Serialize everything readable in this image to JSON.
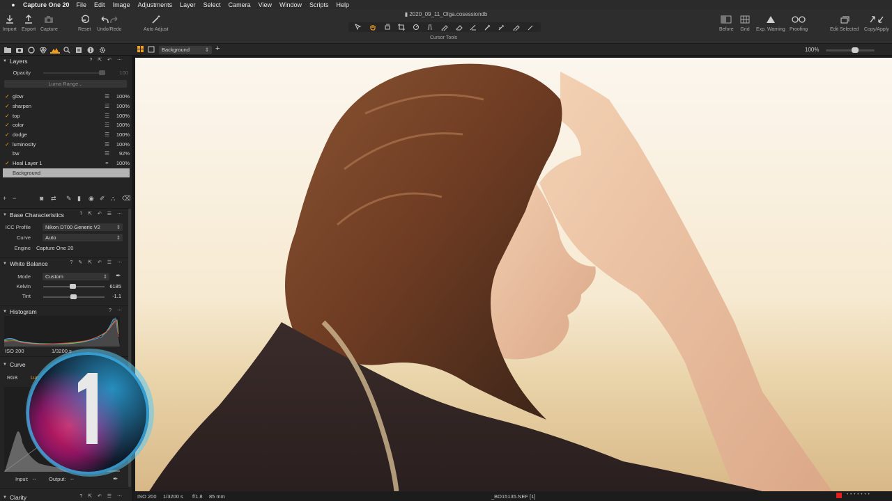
{
  "menubar": {
    "app_name": "Capture One 20",
    "items": [
      "File",
      "Edit",
      "Image",
      "Adjustments",
      "Layer",
      "Select",
      "Camera",
      "View",
      "Window",
      "Scripts",
      "Help"
    ]
  },
  "document": {
    "title": "2020_09_11_Olga.cosessiondb"
  },
  "toolbar": {
    "import": "Import",
    "export": "Export",
    "capture": "Capture",
    "reset": "Reset",
    "undo_redo": "Undo/Redo",
    "auto_adjust": "Auto Adjust",
    "cursor_tools": "Cursor Tools",
    "before": "Before",
    "grid": "Grid",
    "exp_warning": "Exp. Warning",
    "proofing": "Proofing",
    "edit_selected": "Edit Selected",
    "copy_apply": "Copy/Apply"
  },
  "viewer_bar": {
    "variant": "Background",
    "zoom": "100%",
    "zoom_fraction": 0.62
  },
  "layers_panel": {
    "title": "Layers",
    "opacity_label": "Opacity",
    "opacity_value": "100",
    "luma_range": "Luma Range...",
    "layers": [
      {
        "name": "glow",
        "checked": true,
        "opacity": "100%"
      },
      {
        "name": "sharpen",
        "checked": true,
        "opacity": "100%"
      },
      {
        "name": "top",
        "checked": true,
        "opacity": "100%"
      },
      {
        "name": "color",
        "checked": true,
        "opacity": "100%"
      },
      {
        "name": "dodge",
        "checked": true,
        "opacity": "100%"
      },
      {
        "name": "luminosity",
        "checked": true,
        "opacity": "100%"
      },
      {
        "name": "bw",
        "checked": false,
        "opacity": "92%"
      },
      {
        "name": "Heal Layer 1",
        "checked": true,
        "opacity": "100%"
      }
    ],
    "background": "Background"
  },
  "base_characteristics": {
    "title": "Base Characteristics",
    "icc_label": "ICC Profile",
    "icc_value": "Nikon D700 Generic V2",
    "curve_label": "Curve",
    "curve_value": "Auto",
    "engine_label": "Engine",
    "engine_value": "Capture One 20"
  },
  "white_balance": {
    "title": "White Balance",
    "mode_label": "Mode",
    "mode_value": "Custom",
    "kelvin_label": "Kelvin",
    "kelvin_value": "6185",
    "kelvin_fraction": 0.48,
    "tint_label": "Tint",
    "tint_value": "-1.1",
    "tint_fraction": 0.49
  },
  "histogram": {
    "title": "Histogram",
    "iso": "ISO 200",
    "shutter": "1/3200 s"
  },
  "curve_panel": {
    "title": "Curve",
    "tab_rgb": "RGB",
    "tab_luma": "Luma",
    "input_label": "Input:",
    "input_value": "--",
    "output_label": "Output:",
    "output_value": "--"
  },
  "clarity_panel": {
    "title": "Clarity"
  },
  "statusbar": {
    "iso": "ISO 200",
    "shutter": "1/3200 s",
    "aperture": "f/1.8",
    "focal": "85 mm",
    "filename": "_BO15135.NEF [1]"
  },
  "colors": {
    "accent": "#f0a020",
    "panel_bg": "#242424",
    "toolbar_bg": "#2d2d2d"
  }
}
